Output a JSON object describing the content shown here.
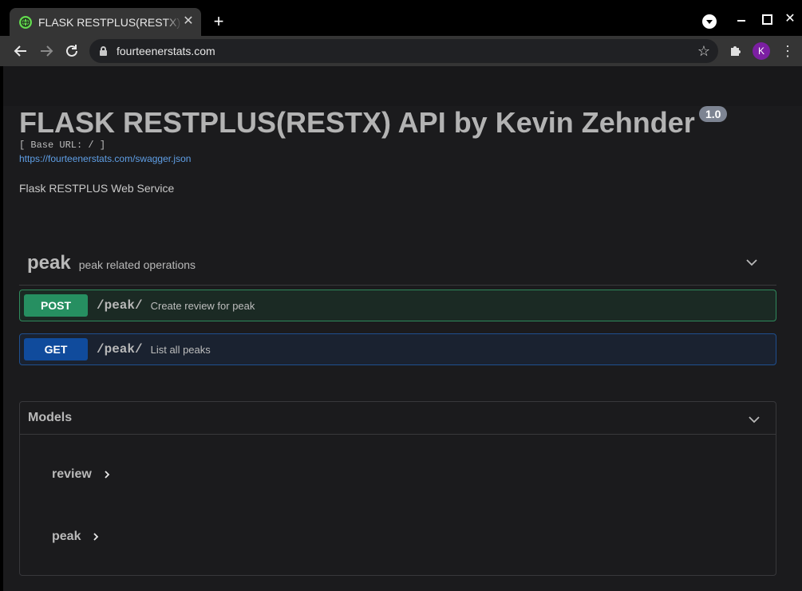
{
  "browser": {
    "tab_title": "FLASK RESTPLUS(RESTX) API",
    "tab_close": "✕",
    "new_tab": "+",
    "url": "fourteenerstats.com",
    "avatar_initial": "K",
    "close_window": "✕"
  },
  "api": {
    "title": "FLASK RESTPLUS(RESTX) API by Kevin Zehnder",
    "version": "1.0",
    "base_url": "[ Base URL: / ]",
    "spec_link": "https://fourteenerstats.com/swagger.json",
    "description": "Flask RESTPLUS Web Service"
  },
  "tag": {
    "name": "peak",
    "description": "peak related operations"
  },
  "operations": [
    {
      "method": "POST",
      "path": "/peak/",
      "summary": "Create review for peak"
    },
    {
      "method": "GET",
      "path": "/peak/",
      "summary": "List all peaks"
    }
  ],
  "models": {
    "title": "Models",
    "items": [
      "review",
      "peak"
    ]
  },
  "colors": {
    "post": "#268f61",
    "get": "#104b9c",
    "link": "#5f9fe6",
    "avatar": "#7b1fa2"
  },
  "icons": [
    "globe-icon",
    "close-icon",
    "plus-icon",
    "back-arrow-icon",
    "forward-arrow-icon",
    "reload-icon",
    "lock-icon",
    "star-icon",
    "puzzle-icon",
    "kebab-menu-icon",
    "chevron-down-icon",
    "chevron-right-icon"
  ]
}
